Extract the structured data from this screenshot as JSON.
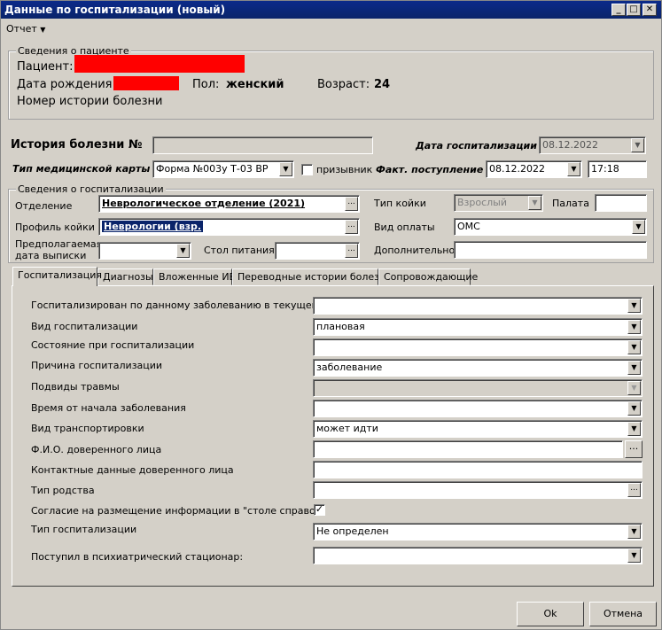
{
  "window": {
    "title": "Данные по госпитализации (новый)"
  },
  "menu": {
    "report": "Отчет"
  },
  "patient": {
    "group_title": "Сведения о пациенте",
    "name_label": "Пациент:",
    "birth_label": "Дата рождения:",
    "sex_label": "Пол:",
    "sex_value": "женский",
    "age_label": "Возраст:",
    "age_value": "24",
    "history_label": "Номер истории болезни"
  },
  "header": {
    "ib_label": "История болезни №",
    "ib_value": "",
    "hosp_date_label": "Дата госпитализации",
    "hosp_date_value": "08.12.2022",
    "card_type_label": "Тип медицинской карты",
    "card_type_value": "Форма №003у Т-03 ВР",
    "conscript_label": "призывник",
    "fact_label": "Факт. поступление",
    "fact_date": "08.12.2022",
    "fact_time": "17:18"
  },
  "hospital": {
    "group_title": "Сведения о госпитализации",
    "dept_label": "Отделение",
    "dept_value": "Неврологическое отделение (2021)",
    "bed_type_label": "Тип койки",
    "bed_type_value": "Взрослый",
    "ward_label": "Палата",
    "ward_value": "",
    "profile_label": "Профиль койки",
    "profile_value": "Неврологии (взр.",
    "pay_label": "Вид оплаты",
    "pay_value": "ОМС",
    "discharge_label_1": "Предполагаемая",
    "discharge_label_2": "дата выписки",
    "discharge_value": "",
    "diet_label": "Стол питания",
    "diet_value": "",
    "extra_label": "Дополнительно",
    "extra_value": ""
  },
  "tabs": [
    {
      "label": "Госпитализация"
    },
    {
      "label": "Диагнозы"
    },
    {
      "label": "Вложенные ИБ"
    },
    {
      "label": "Переводные истории болезни"
    },
    {
      "label": "Сопровождающие"
    }
  ],
  "form": {
    "rows": [
      {
        "label": "Госпитализирован по данному заболеванию в текущем году",
        "value": ""
      },
      {
        "label": "Вид госпитализации",
        "value": "плановая"
      },
      {
        "label": "Состояние при госпитализации",
        "value": ""
      },
      {
        "label": "Причина госпитализации",
        "value": "заболевание"
      },
      {
        "label": "Подвиды травмы",
        "value": ""
      },
      {
        "label": "Время от начала заболевания",
        "value": ""
      },
      {
        "label": "Вид транспортировки",
        "value": "может идти"
      },
      {
        "label": "Ф.И.О. доверенного лица",
        "value": ""
      },
      {
        "label": "Контактные данные доверенного лица",
        "value": ""
      },
      {
        "label": "Тип родства",
        "value": ""
      },
      {
        "label": "Согласие на размещение информации в \"столе справок\"",
        "value": ""
      },
      {
        "label": "Тип госпитализации",
        "value": "Не определен"
      },
      {
        "label": "Поступил в психиатрический стационар:",
        "value": ""
      }
    ]
  },
  "buttons": {
    "ok": "Ok",
    "cancel": "Отмена"
  }
}
